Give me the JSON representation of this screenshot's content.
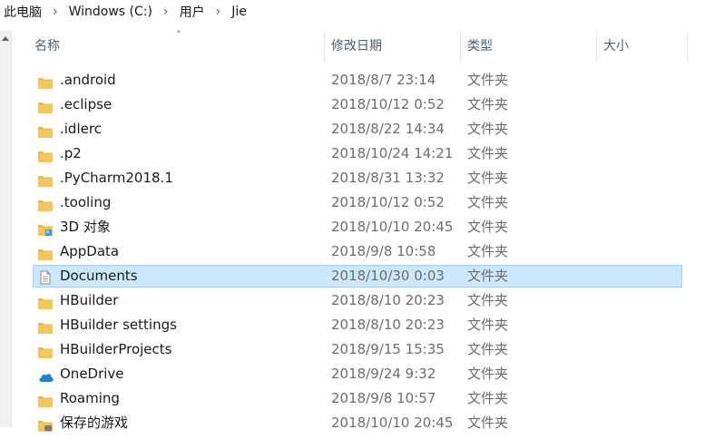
{
  "breadcrumb": [
    {
      "label": "此电脑"
    },
    {
      "label": "Windows (C:)"
    },
    {
      "label": "用户"
    },
    {
      "label": "Jie"
    }
  ],
  "columns": {
    "name": "名称",
    "date": "修改日期",
    "type": "类型",
    "size": "大小"
  },
  "rows": [
    {
      "name": ".android",
      "date": "2018/8/7 23:14",
      "type": "文件夹",
      "icon": "folder-icon"
    },
    {
      "name": ".eclipse",
      "date": "2018/10/12 0:52",
      "type": "文件夹",
      "icon": "folder-icon"
    },
    {
      "name": ".idlerc",
      "date": "2018/8/22 14:34",
      "type": "文件夹",
      "icon": "folder-icon"
    },
    {
      "name": ".p2",
      "date": "2018/10/24 14:21",
      "type": "文件夹",
      "icon": "folder-icon"
    },
    {
      "name": ".PyCharm2018.1",
      "date": "2018/8/31 13:32",
      "type": "文件夹",
      "icon": "folder-icon"
    },
    {
      "name": ".tooling",
      "date": "2018/10/12 0:52",
      "type": "文件夹",
      "icon": "folder-icon"
    },
    {
      "name": "3D 对象",
      "date": "2018/10/10 20:45",
      "type": "文件夹",
      "icon": "3d-objects-folder-icon"
    },
    {
      "name": "AppData",
      "date": "2018/9/8 10:58",
      "type": "文件夹",
      "icon": "folder-icon"
    },
    {
      "name": "Documents",
      "date": "2018/10/30 0:03",
      "type": "文件夹",
      "icon": "documents-folder-icon",
      "selected": true
    },
    {
      "name": "HBuilder",
      "date": "2018/8/10 20:23",
      "type": "文件夹",
      "icon": "folder-icon"
    },
    {
      "name": "HBuilder settings",
      "date": "2018/8/10 20:23",
      "type": "文件夹",
      "icon": "folder-icon"
    },
    {
      "name": "HBuilderProjects",
      "date": "2018/9/15 15:35",
      "type": "文件夹",
      "icon": "folder-icon"
    },
    {
      "name": "OneDrive",
      "date": "2018/9/24 9:32",
      "type": "文件夹",
      "icon": "onedrive-cloud-icon"
    },
    {
      "name": "Roaming",
      "date": "2018/9/8 10:57",
      "type": "文件夹",
      "icon": "folder-icon"
    },
    {
      "name": "保存的游戏",
      "date": "2018/10/10 20:45",
      "type": "文件夹",
      "icon": "saved-games-folder-icon"
    }
  ],
  "colors": {
    "folder": "#e8b84b",
    "selection": "#cce8ff",
    "selection_border": "#99d1ff",
    "header_text": "#4c607a"
  }
}
